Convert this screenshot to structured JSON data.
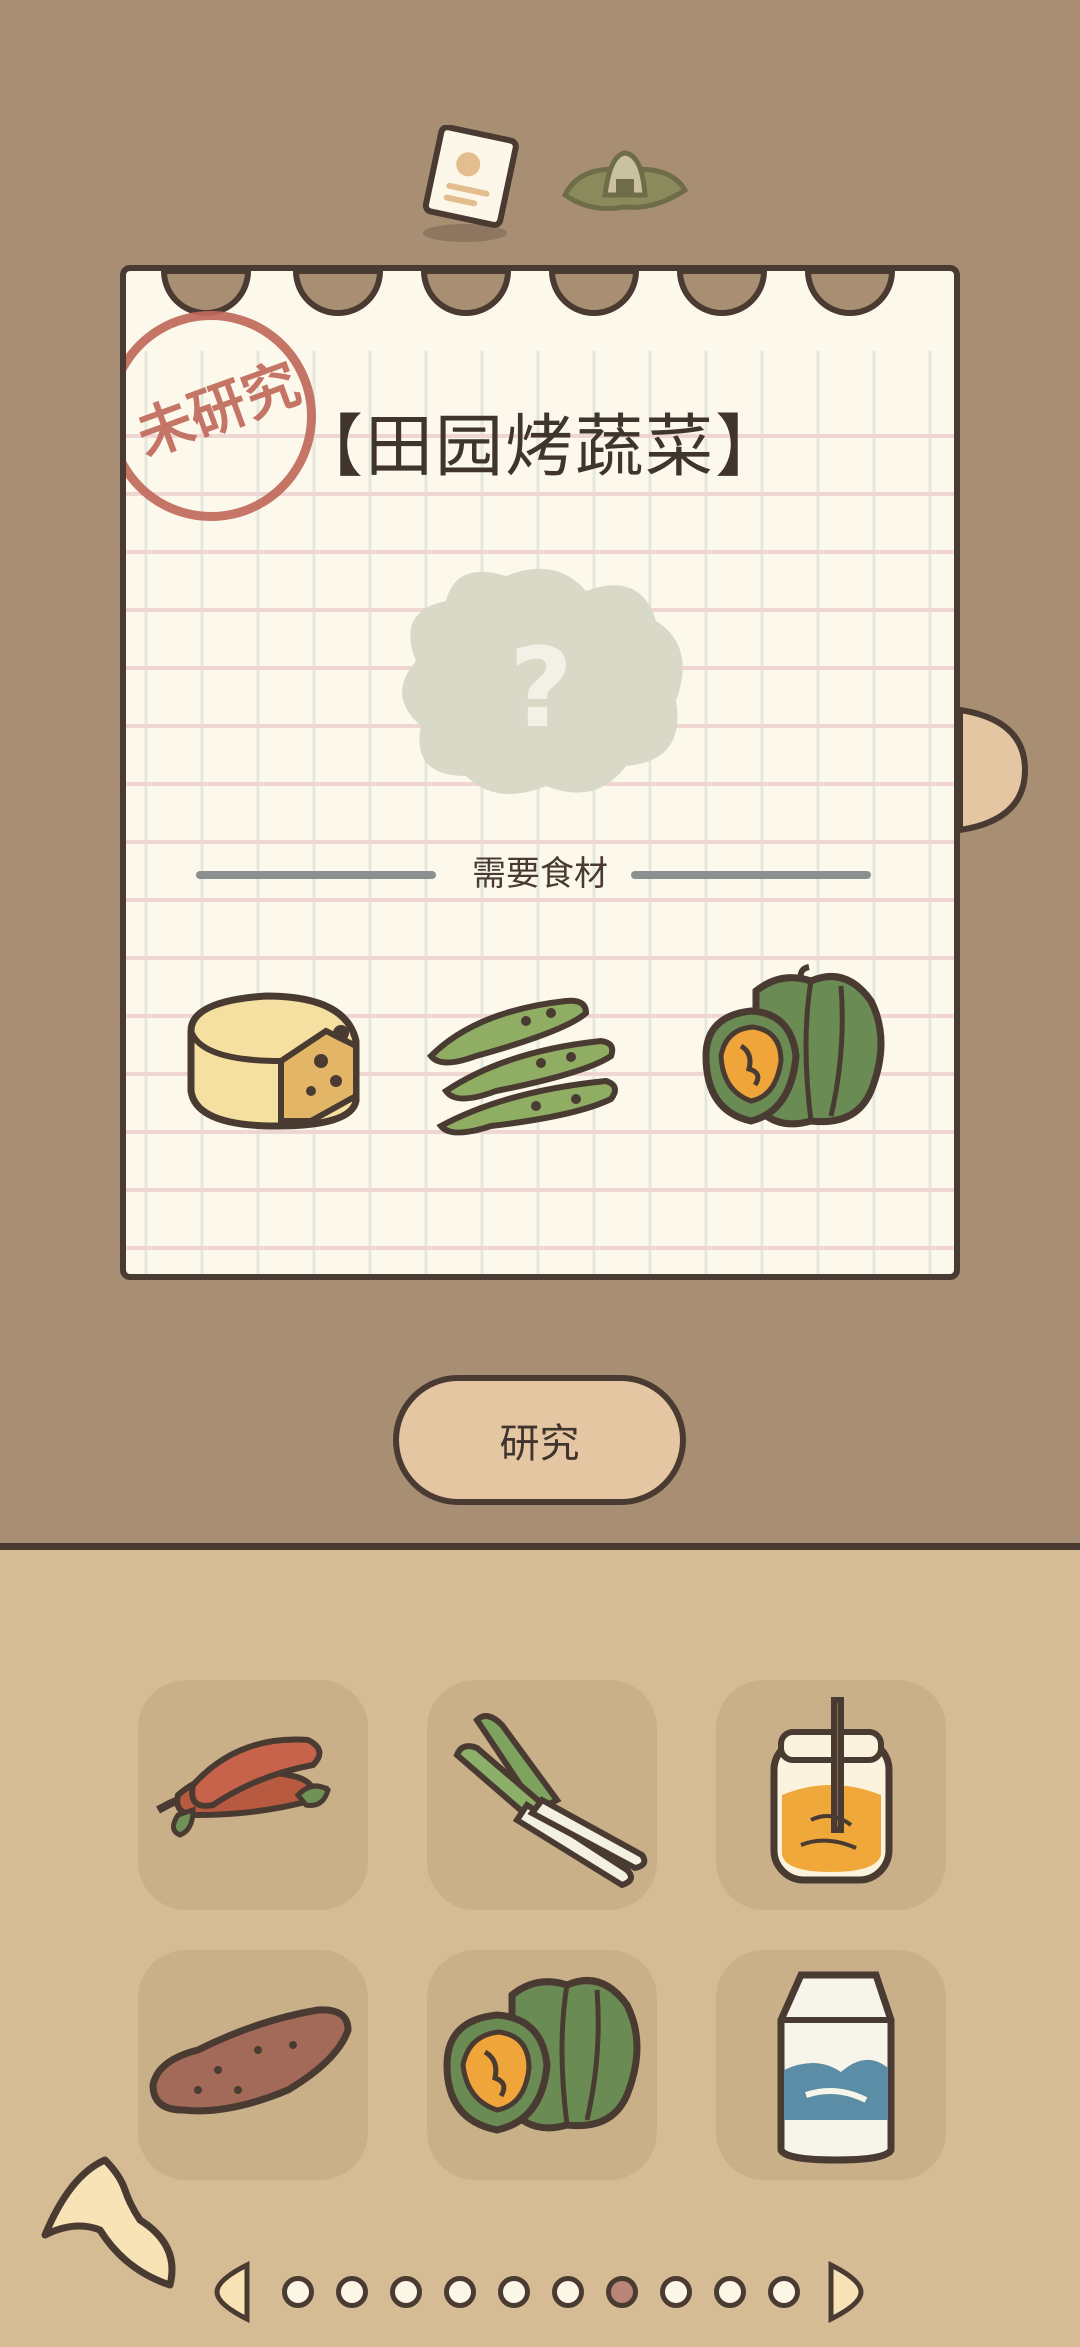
{
  "recipe": {
    "title": "【田园烤蔬菜】",
    "stamp": "未研究",
    "unknown_symbol": "?",
    "required_label": "需要食材",
    "required_ingredients": [
      "cheese-icon",
      "edamame-icon",
      "pumpkin-icon"
    ]
  },
  "actions": {
    "research_label": "研究"
  },
  "inventory": {
    "items": [
      "chili-pepper-icon",
      "green-onion-icon",
      "honey-jar-icon",
      "sweet-potato-icon",
      "pumpkin-icon",
      "milk-carton-icon"
    ]
  },
  "pager": {
    "total": 10,
    "active_index": 6
  },
  "colors": {
    "top_bg": "#a88f73",
    "bottom_bg": "#d6bc94",
    "paper": "#fcf9ec",
    "outline": "#4a3b32",
    "stamp": "#c06a5b",
    "button": "#e4c6a2"
  }
}
